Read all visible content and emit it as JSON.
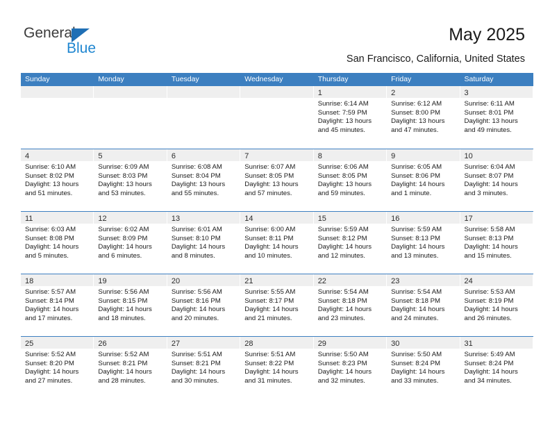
{
  "brand": {
    "name_top": "General",
    "name_bottom": "Blue",
    "triangle_color": "#1f6fb5",
    "blue_text_color": "#1f86d0",
    "top_text_color": "#3b3b3b"
  },
  "header": {
    "title": "May 2025",
    "subtitle": "San Francisco, California, United States"
  },
  "theme": {
    "header_blue": "#3c7fc0",
    "daynum_band": "#efefef",
    "text": "#1a1a1a"
  },
  "labels": {
    "sunrise_prefix": "Sunrise: ",
    "sunset_prefix": "Sunset: ",
    "daylight_prefix": "Daylight: "
  },
  "weekdays": [
    "Sunday",
    "Monday",
    "Tuesday",
    "Wednesday",
    "Thursday",
    "Friday",
    "Saturday"
  ],
  "weeks": [
    [
      {
        "blank": true
      },
      {
        "blank": true
      },
      {
        "blank": true
      },
      {
        "blank": true
      },
      {
        "day": "1",
        "sunrise": "Sunrise: 6:14 AM",
        "sunset": "Sunset: 7:59 PM",
        "daylight": "Daylight: 13 hours and 45 minutes."
      },
      {
        "day": "2",
        "sunrise": "Sunrise: 6:12 AM",
        "sunset": "Sunset: 8:00 PM",
        "daylight": "Daylight: 13 hours and 47 minutes."
      },
      {
        "day": "3",
        "sunrise": "Sunrise: 6:11 AM",
        "sunset": "Sunset: 8:01 PM",
        "daylight": "Daylight: 13 hours and 49 minutes."
      }
    ],
    [
      {
        "day": "4",
        "sunrise": "Sunrise: 6:10 AM",
        "sunset": "Sunset: 8:02 PM",
        "daylight": "Daylight: 13 hours and 51 minutes."
      },
      {
        "day": "5",
        "sunrise": "Sunrise: 6:09 AM",
        "sunset": "Sunset: 8:03 PM",
        "daylight": "Daylight: 13 hours and 53 minutes."
      },
      {
        "day": "6",
        "sunrise": "Sunrise: 6:08 AM",
        "sunset": "Sunset: 8:04 PM",
        "daylight": "Daylight: 13 hours and 55 minutes."
      },
      {
        "day": "7",
        "sunrise": "Sunrise: 6:07 AM",
        "sunset": "Sunset: 8:05 PM",
        "daylight": "Daylight: 13 hours and 57 minutes."
      },
      {
        "day": "8",
        "sunrise": "Sunrise: 6:06 AM",
        "sunset": "Sunset: 8:05 PM",
        "daylight": "Daylight: 13 hours and 59 minutes."
      },
      {
        "day": "9",
        "sunrise": "Sunrise: 6:05 AM",
        "sunset": "Sunset: 8:06 PM",
        "daylight": "Daylight: 14 hours and 1 minute."
      },
      {
        "day": "10",
        "sunrise": "Sunrise: 6:04 AM",
        "sunset": "Sunset: 8:07 PM",
        "daylight": "Daylight: 14 hours and 3 minutes."
      }
    ],
    [
      {
        "day": "11",
        "sunrise": "Sunrise: 6:03 AM",
        "sunset": "Sunset: 8:08 PM",
        "daylight": "Daylight: 14 hours and 5 minutes."
      },
      {
        "day": "12",
        "sunrise": "Sunrise: 6:02 AM",
        "sunset": "Sunset: 8:09 PM",
        "daylight": "Daylight: 14 hours and 6 minutes."
      },
      {
        "day": "13",
        "sunrise": "Sunrise: 6:01 AM",
        "sunset": "Sunset: 8:10 PM",
        "daylight": "Daylight: 14 hours and 8 minutes."
      },
      {
        "day": "14",
        "sunrise": "Sunrise: 6:00 AM",
        "sunset": "Sunset: 8:11 PM",
        "daylight": "Daylight: 14 hours and 10 minutes."
      },
      {
        "day": "15",
        "sunrise": "Sunrise: 5:59 AM",
        "sunset": "Sunset: 8:12 PM",
        "daylight": "Daylight: 14 hours and 12 minutes."
      },
      {
        "day": "16",
        "sunrise": "Sunrise: 5:59 AM",
        "sunset": "Sunset: 8:13 PM",
        "daylight": "Daylight: 14 hours and 13 minutes."
      },
      {
        "day": "17",
        "sunrise": "Sunrise: 5:58 AM",
        "sunset": "Sunset: 8:13 PM",
        "daylight": "Daylight: 14 hours and 15 minutes."
      }
    ],
    [
      {
        "day": "18",
        "sunrise": "Sunrise: 5:57 AM",
        "sunset": "Sunset: 8:14 PM",
        "daylight": "Daylight: 14 hours and 17 minutes."
      },
      {
        "day": "19",
        "sunrise": "Sunrise: 5:56 AM",
        "sunset": "Sunset: 8:15 PM",
        "daylight": "Daylight: 14 hours and 18 minutes."
      },
      {
        "day": "20",
        "sunrise": "Sunrise: 5:56 AM",
        "sunset": "Sunset: 8:16 PM",
        "daylight": "Daylight: 14 hours and 20 minutes."
      },
      {
        "day": "21",
        "sunrise": "Sunrise: 5:55 AM",
        "sunset": "Sunset: 8:17 PM",
        "daylight": "Daylight: 14 hours and 21 minutes."
      },
      {
        "day": "22",
        "sunrise": "Sunrise: 5:54 AM",
        "sunset": "Sunset: 8:18 PM",
        "daylight": "Daylight: 14 hours and 23 minutes."
      },
      {
        "day": "23",
        "sunrise": "Sunrise: 5:54 AM",
        "sunset": "Sunset: 8:18 PM",
        "daylight": "Daylight: 14 hours and 24 minutes."
      },
      {
        "day": "24",
        "sunrise": "Sunrise: 5:53 AM",
        "sunset": "Sunset: 8:19 PM",
        "daylight": "Daylight: 14 hours and 26 minutes."
      }
    ],
    [
      {
        "day": "25",
        "sunrise": "Sunrise: 5:52 AM",
        "sunset": "Sunset: 8:20 PM",
        "daylight": "Daylight: 14 hours and 27 minutes."
      },
      {
        "day": "26",
        "sunrise": "Sunrise: 5:52 AM",
        "sunset": "Sunset: 8:21 PM",
        "daylight": "Daylight: 14 hours and 28 minutes."
      },
      {
        "day": "27",
        "sunrise": "Sunrise: 5:51 AM",
        "sunset": "Sunset: 8:21 PM",
        "daylight": "Daylight: 14 hours and 30 minutes."
      },
      {
        "day": "28",
        "sunrise": "Sunrise: 5:51 AM",
        "sunset": "Sunset: 8:22 PM",
        "daylight": "Daylight: 14 hours and 31 minutes."
      },
      {
        "day": "29",
        "sunrise": "Sunrise: 5:50 AM",
        "sunset": "Sunset: 8:23 PM",
        "daylight": "Daylight: 14 hours and 32 minutes."
      },
      {
        "day": "30",
        "sunrise": "Sunrise: 5:50 AM",
        "sunset": "Sunset: 8:24 PM",
        "daylight": "Daylight: 14 hours and 33 minutes."
      },
      {
        "day": "31",
        "sunrise": "Sunrise: 5:49 AM",
        "sunset": "Sunset: 8:24 PM",
        "daylight": "Daylight: 14 hours and 34 minutes."
      }
    ]
  ]
}
